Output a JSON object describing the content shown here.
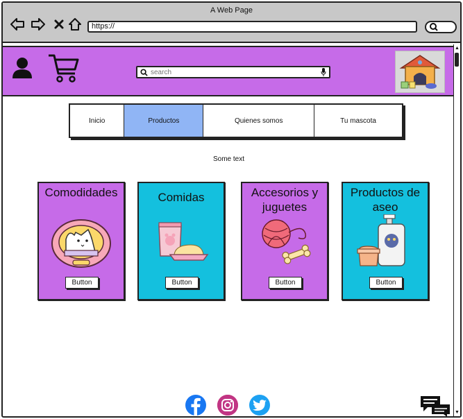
{
  "browser": {
    "window_title": "A Web Page",
    "url": "https://",
    "icons": [
      "back-arrow-icon",
      "forward-arrow-icon",
      "close-x-icon",
      "home-icon",
      "search-icon"
    ]
  },
  "header": {
    "search_placeholder": "search",
    "icons": [
      "user-icon",
      "cart-icon",
      "search-icon",
      "microphone-icon",
      "pet-house-logo"
    ]
  },
  "menu": {
    "items": [
      {
        "label": "Inicio",
        "active": false
      },
      {
        "label": "Productos",
        "active": true
      },
      {
        "label": "Quienes somos",
        "active": false
      },
      {
        "label": "Tu mascota",
        "active": false
      }
    ]
  },
  "main": {
    "text": "Some text"
  },
  "cards": [
    {
      "title": "Comodidades",
      "button": "Button",
      "color": "#c66be8",
      "icon": "pet-bed-cat-icon"
    },
    {
      "title": "Comidas",
      "button": "Button",
      "color": "#14c0de",
      "icon": "pet-food-icon"
    },
    {
      "title": "Accesorios y juguetes",
      "button": "Button",
      "color": "#c66be8",
      "icon": "yarn-bone-toys-icon"
    },
    {
      "title": "Productos de aseo",
      "button": "Button",
      "color": "#14c0de",
      "icon": "shampoo-bottle-icon"
    }
  ],
  "footer": {
    "icons": [
      "facebook-icon",
      "instagram-icon",
      "twitter-icon",
      "chat-icon"
    ]
  }
}
